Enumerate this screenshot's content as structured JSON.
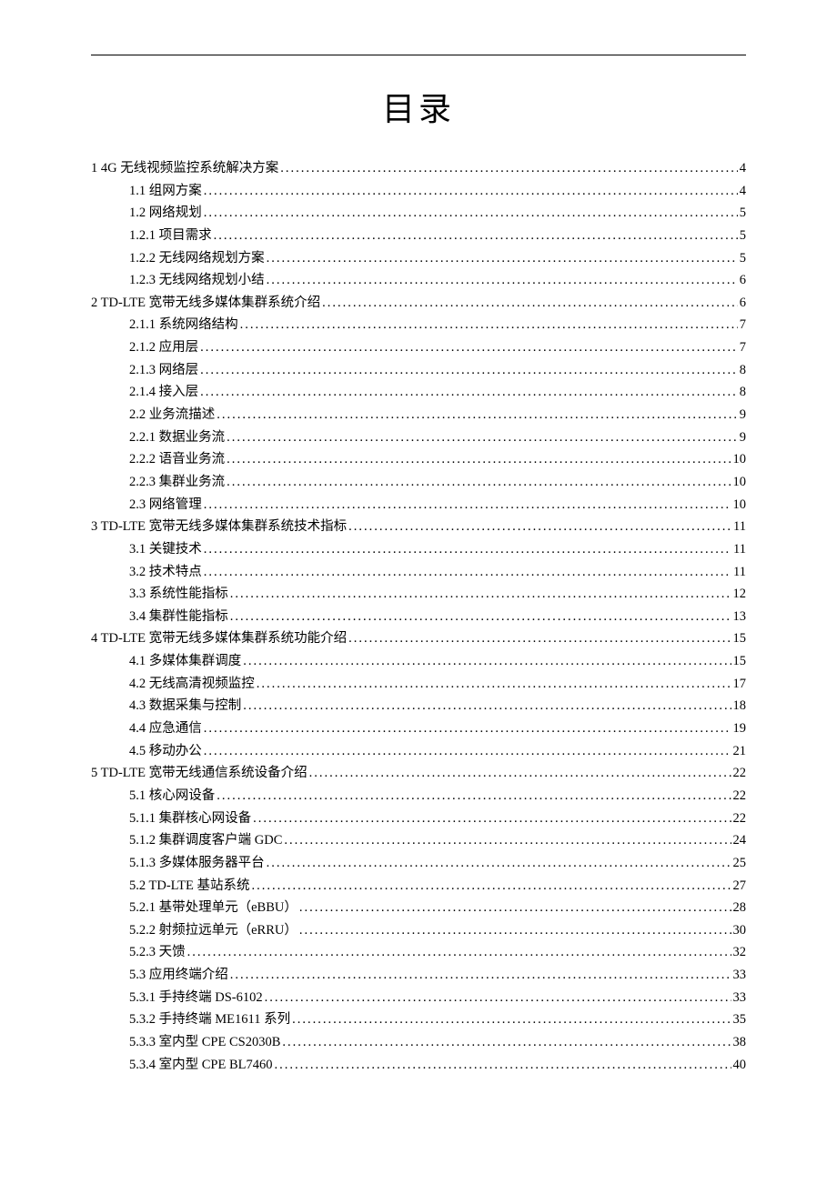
{
  "title": "目录",
  "toc": [
    {
      "level": 0,
      "label": "1 4G 无线视频监控系统解决方案",
      "page": "4"
    },
    {
      "level": 1,
      "label": "1.1 组网方案",
      "page": "4"
    },
    {
      "level": 1,
      "label": "1.2 网络规划",
      "page": "5"
    },
    {
      "level": 2,
      "label": "1.2.1 项目需求",
      "page": "5"
    },
    {
      "level": 2,
      "label": "1.2.2 无线网络规划方案",
      "page": "5"
    },
    {
      "level": 2,
      "label": "1.2.3 无线网络规划小结",
      "page": "6"
    },
    {
      "level": 0,
      "label": "2 TD-LTE 宽带无线多媒体集群系统介绍",
      "page": "6"
    },
    {
      "level": 2,
      "label": "2.1.1 系统网络结构",
      "page": "7"
    },
    {
      "level": 2,
      "label": "2.1.2 应用层",
      "page": "7"
    },
    {
      "level": 2,
      "label": "2.1.3 网络层",
      "page": "8"
    },
    {
      "level": 2,
      "label": "2.1.4 接入层",
      "page": "8"
    },
    {
      "level": 1,
      "label": "2.2 业务流描述",
      "page": "9"
    },
    {
      "level": 2,
      "label": "2.2.1 数据业务流",
      "page": "9"
    },
    {
      "level": 2,
      "label": "2.2.2 语音业务流",
      "page": "10"
    },
    {
      "level": 2,
      "label": "2.2.3 集群业务流",
      "page": "10"
    },
    {
      "level": 1,
      "label": "2.3 网络管理",
      "page": "10"
    },
    {
      "level": 0,
      "label": "3 TD-LTE 宽带无线多媒体集群系统技术指标",
      "page": "11"
    },
    {
      "level": 1,
      "label": "3.1 关键技术",
      "page": "11"
    },
    {
      "level": 1,
      "label": "3.2 技术特点",
      "page": "11"
    },
    {
      "level": 1,
      "label": "3.3 系统性能指标",
      "page": "12"
    },
    {
      "level": 1,
      "label": "3.4 集群性能指标",
      "page": "13"
    },
    {
      "level": 0,
      "label": "4 TD-LTE 宽带无线多媒体集群系统功能介绍",
      "page": "15"
    },
    {
      "level": 1,
      "label": "4.1 多媒体集群调度",
      "page": "15"
    },
    {
      "level": 1,
      "label": "4.2 无线高清视频监控",
      "page": "17"
    },
    {
      "level": 1,
      "label": "4.3 数据采集与控制",
      "page": "18"
    },
    {
      "level": 1,
      "label": "4.4 应急通信",
      "page": "19"
    },
    {
      "level": 1,
      "label": "4.5 移动办公",
      "page": "21"
    },
    {
      "level": 0,
      "label": "5 TD-LTE 宽带无线通信系统设备介绍",
      "page": "22"
    },
    {
      "level": 1,
      "label": "5.1 核心网设备",
      "page": "22"
    },
    {
      "level": 2,
      "label": "5.1.1 集群核心网设备",
      "page": "22"
    },
    {
      "level": 2,
      "label": "5.1.2 集群调度客户端 GDC",
      "page": "24"
    },
    {
      "level": 2,
      "label": "5.1.3 多媒体服务器平台",
      "page": "25"
    },
    {
      "level": 1,
      "label": "5.2 TD-LTE 基站系统",
      "page": "27"
    },
    {
      "level": 2,
      "label": "5.2.1 基带处理单元（eBBU）",
      "page": "28"
    },
    {
      "level": 2,
      "label": "5.2.2 射频拉远单元（eRRU）",
      "page": "30"
    },
    {
      "level": 2,
      "label": "5.2.3 天馈",
      "page": "32"
    },
    {
      "level": 1,
      "label": "5.3 应用终端介绍",
      "page": "33"
    },
    {
      "level": 2,
      "label": "5.3.1 手持终端 DS-6102",
      "page": "33"
    },
    {
      "level": 2,
      "label": "5.3.2 手持终端 ME1611 系列",
      "page": "35"
    },
    {
      "level": 2,
      "label": "5.3.3 室内型 CPE CS2030B",
      "page": "38"
    },
    {
      "level": 2,
      "label": "5.3.4 室内型 CPE BL7460",
      "page": "40"
    }
  ]
}
